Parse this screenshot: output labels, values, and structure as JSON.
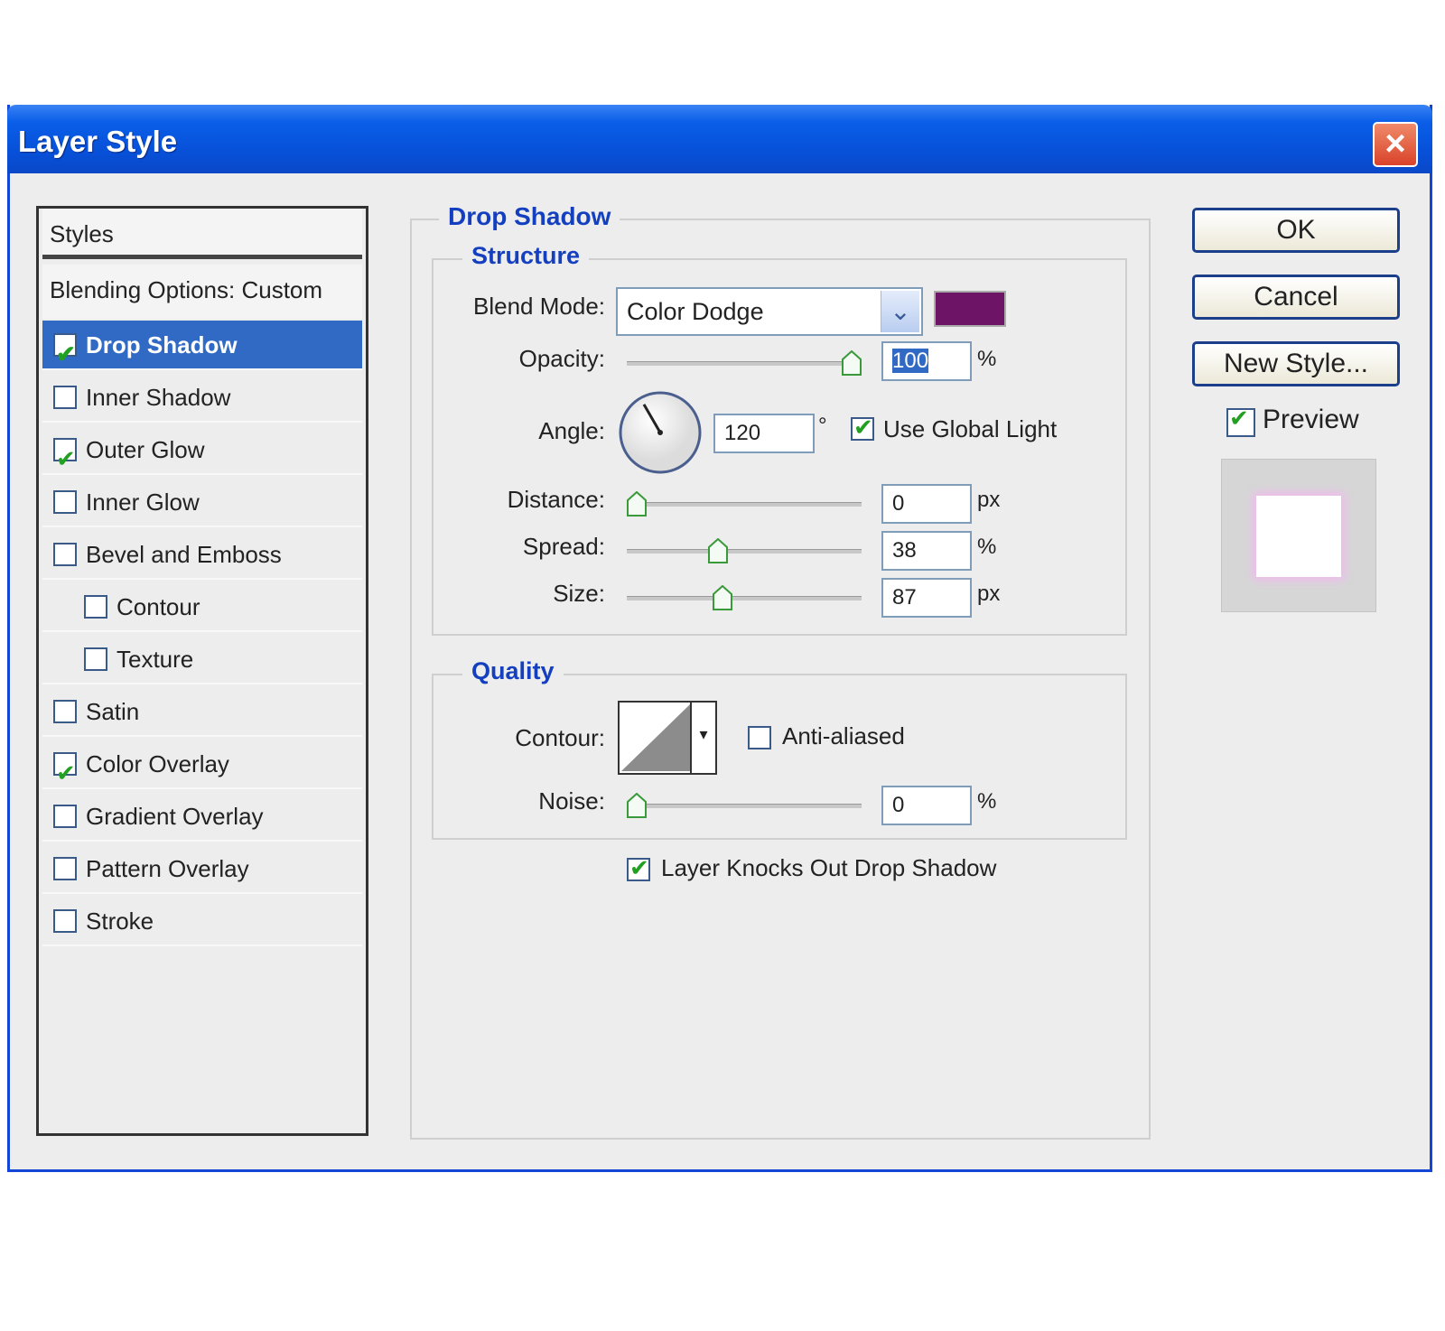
{
  "window": {
    "title": "Layer Style"
  },
  "style_list": {
    "header": "Styles",
    "blending": "Blending Options: Custom",
    "items": [
      {
        "label": "Drop Shadow",
        "checked": true,
        "selected": true,
        "indent": false
      },
      {
        "label": "Inner Shadow",
        "checked": false,
        "selected": false,
        "indent": false
      },
      {
        "label": "Outer Glow",
        "checked": true,
        "selected": false,
        "indent": false
      },
      {
        "label": "Inner Glow",
        "checked": false,
        "selected": false,
        "indent": false
      },
      {
        "label": "Bevel and Emboss",
        "checked": false,
        "selected": false,
        "indent": false
      },
      {
        "label": "Contour",
        "checked": false,
        "selected": false,
        "indent": true
      },
      {
        "label": "Texture",
        "checked": false,
        "selected": false,
        "indent": true
      },
      {
        "label": "Satin",
        "checked": false,
        "selected": false,
        "indent": false
      },
      {
        "label": "Color Overlay",
        "checked": true,
        "selected": false,
        "indent": false
      },
      {
        "label": "Gradient Overlay",
        "checked": false,
        "selected": false,
        "indent": false
      },
      {
        "label": "Pattern Overlay",
        "checked": false,
        "selected": false,
        "indent": false
      },
      {
        "label": "Stroke",
        "checked": false,
        "selected": false,
        "indent": false
      }
    ]
  },
  "panel": {
    "title": "Drop Shadow",
    "structure": {
      "title": "Structure",
      "blend_mode_label": "Blend Mode:",
      "blend_mode_value": "Color Dodge",
      "shadow_color": "#6e1467",
      "opacity_label": "Opacity:",
      "opacity_value": "100",
      "opacity_unit": "%",
      "opacity_level": 1.0,
      "angle_label": "Angle:",
      "angle_value": "120",
      "angle_unit": "°",
      "use_global_light_label": "Use Global Light",
      "use_global_light": true,
      "distance_label": "Distance:",
      "distance_value": "0",
      "distance_unit": "px",
      "distance_level": 0.0,
      "spread_label": "Spread:",
      "spread_value": "38",
      "spread_unit": "%",
      "spread_level": 0.38,
      "size_label": "Size:",
      "size_value": "87",
      "size_unit": "px",
      "size_level": 0.4
    },
    "quality": {
      "title": "Quality",
      "contour_label": "Contour:",
      "anti_aliased_label": "Anti-aliased",
      "anti_aliased": false,
      "noise_label": "Noise:",
      "noise_value": "0",
      "noise_unit": "%",
      "noise_level": 0.0
    },
    "knockout_label": "Layer Knocks Out Drop Shadow",
    "knockout": true
  },
  "buttons": {
    "ok": "OK",
    "cancel": "Cancel",
    "new_style": "New Style..."
  },
  "preview": {
    "label": "Preview",
    "checked": true
  }
}
